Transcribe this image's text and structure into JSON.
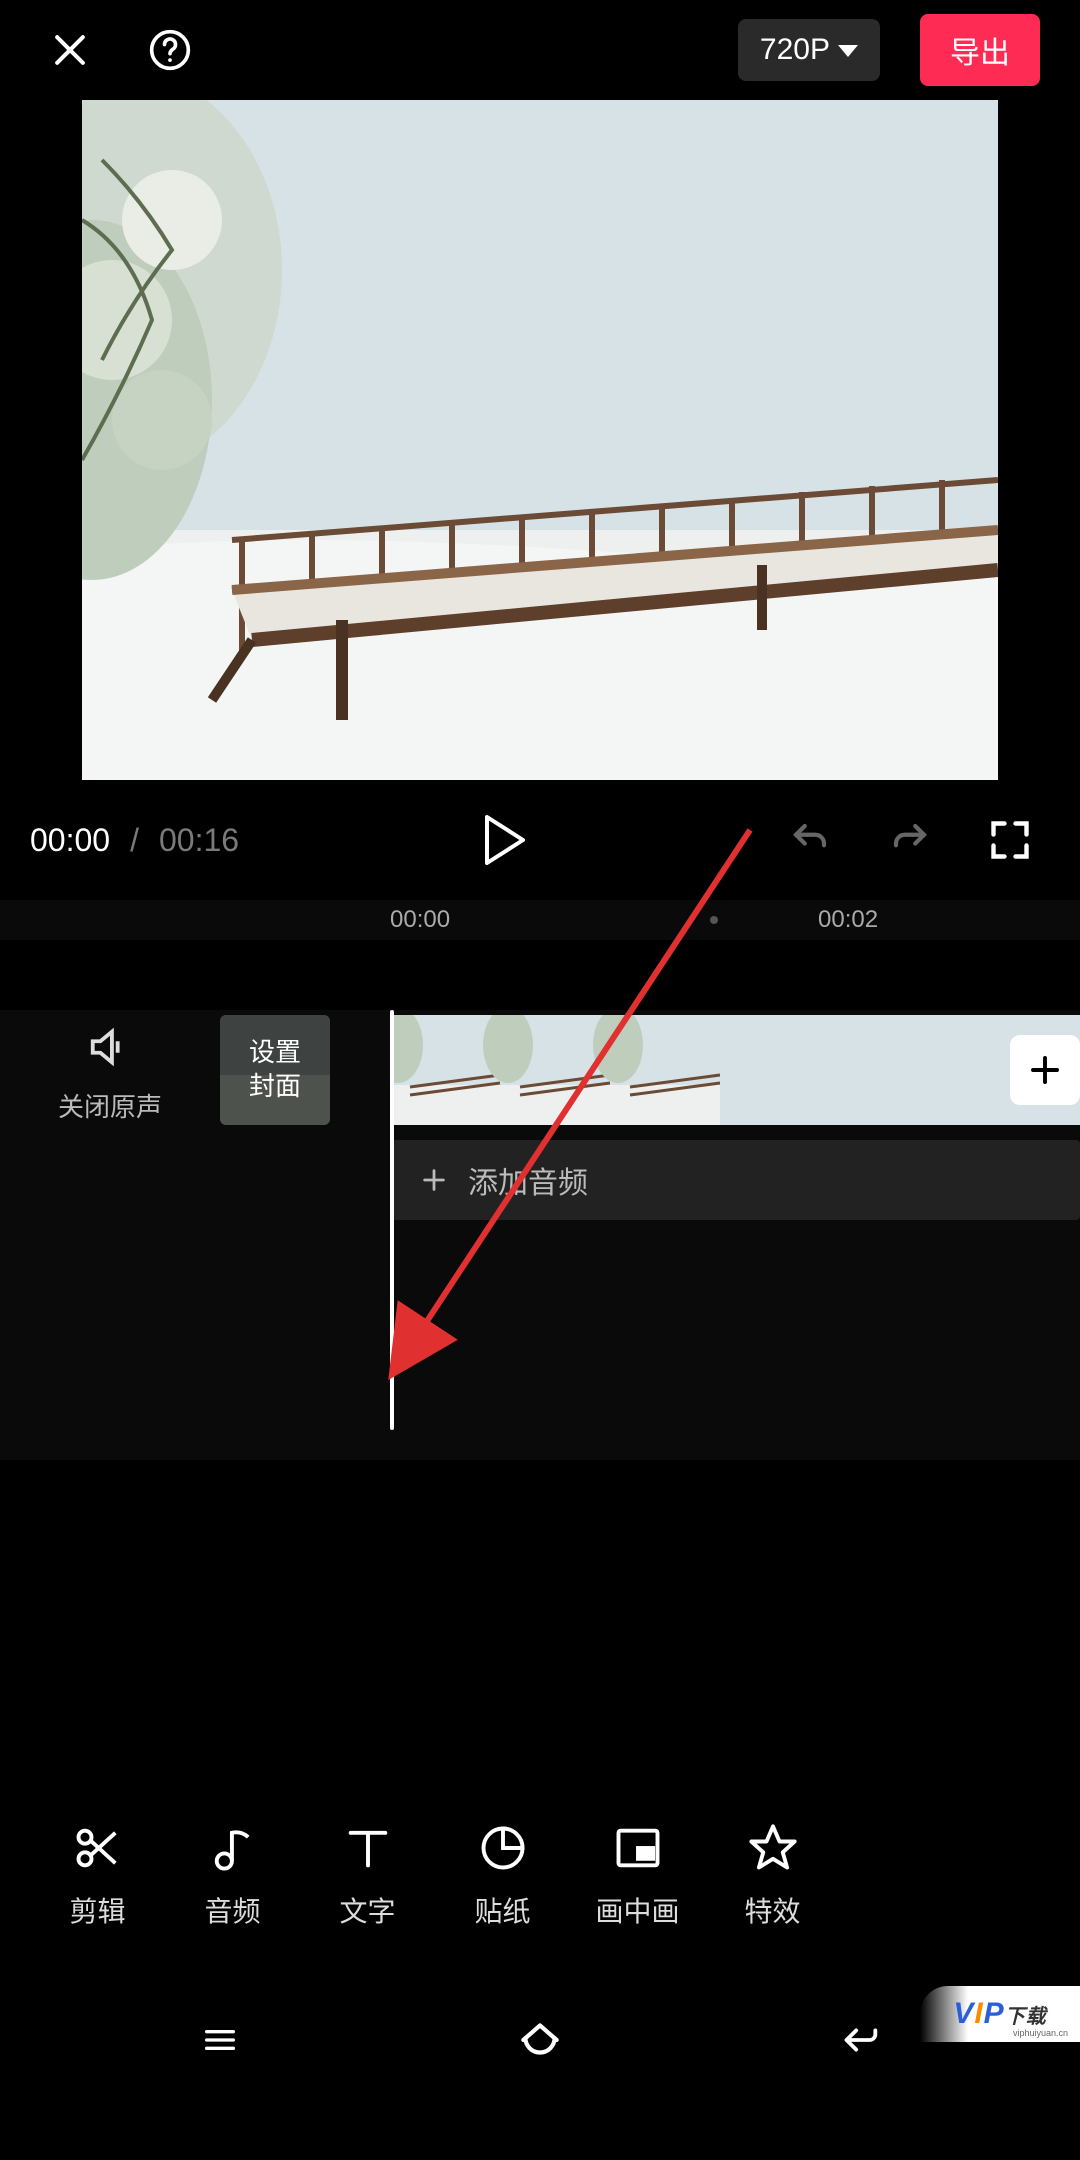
{
  "header": {
    "resolution_label": "720P",
    "export_label": "导出"
  },
  "player": {
    "current_time": "00:00",
    "separator": " / ",
    "total_time": "00:16"
  },
  "ruler": {
    "t0": "00:00",
    "t1": "00:02"
  },
  "timeline": {
    "mute_label": "关闭原声",
    "cover_label_line1": "设置",
    "cover_label_line2": "封面",
    "add_audio_label": "添加音频"
  },
  "toolbar": {
    "items": [
      {
        "label": "剪辑"
      },
      {
        "label": "音频"
      },
      {
        "label": "文字"
      },
      {
        "label": "贴纸"
      },
      {
        "label": "画中画"
      },
      {
        "label": "特效"
      }
    ]
  },
  "watermark": {
    "brand": "VIP下载",
    "domain": "viphuiyuan.cn"
  }
}
